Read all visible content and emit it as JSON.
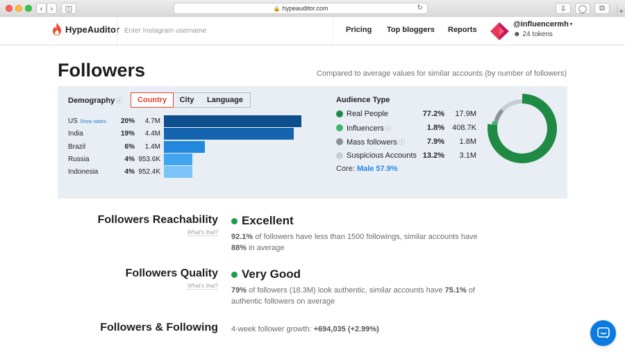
{
  "browser": {
    "url": "hypeauditor.com",
    "traffic_lights": {
      "close": "#fc605c",
      "minimize": "#fdbc40",
      "zoom": "#34c84a"
    }
  },
  "header": {
    "logo_text": "HypeAuditor",
    "search_placeholder": "Enter Instagram username",
    "nav": [
      "Pricing",
      "Top bloggers",
      "Reports"
    ],
    "username": "@influencermh",
    "tokens": "24 tokens"
  },
  "title": "Followers",
  "compare_note": "Compared to average values for similar accounts (by number of followers)",
  "demography": {
    "title": "Demography",
    "tabs": [
      "Country",
      "City",
      "Language"
    ],
    "active_tab": "Country",
    "show_states_label": "Show states",
    "rows": [
      {
        "name": "US",
        "pct": "20%",
        "count": "4.7M",
        "share": 1.0,
        "color": "#0d4f8c"
      },
      {
        "name": "India",
        "pct": "19%",
        "count": "4.4M",
        "share": 0.946,
        "color": "#1564b0"
      },
      {
        "name": "Brazil",
        "pct": "6%",
        "count": "1.4M",
        "share": 0.3,
        "color": "#2288dd"
      },
      {
        "name": "Russia",
        "pct": "4%",
        "count": "953.6K",
        "share": 0.205,
        "color": "#42a5f0"
      },
      {
        "name": "Indonesia",
        "pct": "4%",
        "count": "952.4K",
        "share": 0.205,
        "color": "#7cc4f8"
      }
    ]
  },
  "audience": {
    "title": "Audience Type",
    "rows": [
      {
        "label": "Real People",
        "pct": "77.2%",
        "count": "17.9M",
        "color": "#1f8a44",
        "value": 77.2,
        "help": false
      },
      {
        "label": "Influencers",
        "pct": "1.8%",
        "count": "408.7K",
        "color": "#3cb66a",
        "value": 1.8,
        "help": true
      },
      {
        "label": "Mass followers",
        "pct": "7.9%",
        "count": "1.8M",
        "color": "#8a9299",
        "value": 7.9,
        "help": true
      },
      {
        "label": "Suspicious Accounts",
        "pct": "13.2%",
        "count": "3.1M",
        "color": "#c6cdd3",
        "value": 13.2,
        "help": false
      }
    ],
    "core_label": "Core:",
    "core_value": "Male 57.9%"
  },
  "reachability": {
    "heading": "Followers Reachability",
    "whats": "What's that?",
    "status": "Excellent",
    "text_pct": "92.1%",
    "text_mid": " of followers have less than 1500 followings, similar accounts have ",
    "text_pct2": "88%",
    "text_end": " in average"
  },
  "quality": {
    "heading": "Followers Quality",
    "whats": "What's that?",
    "status": "Very Good",
    "text_pct": "79%",
    "text_mid": " of followers (18.3M) look authentic, similar accounts have ",
    "text_pct2": "75.1%",
    "text_end": " of authentic followers on average"
  },
  "following": {
    "heading": "Followers & Following",
    "growth_label": "4-week follower growth: ",
    "growth_value": "+694,035 (+2.99%)"
  }
}
